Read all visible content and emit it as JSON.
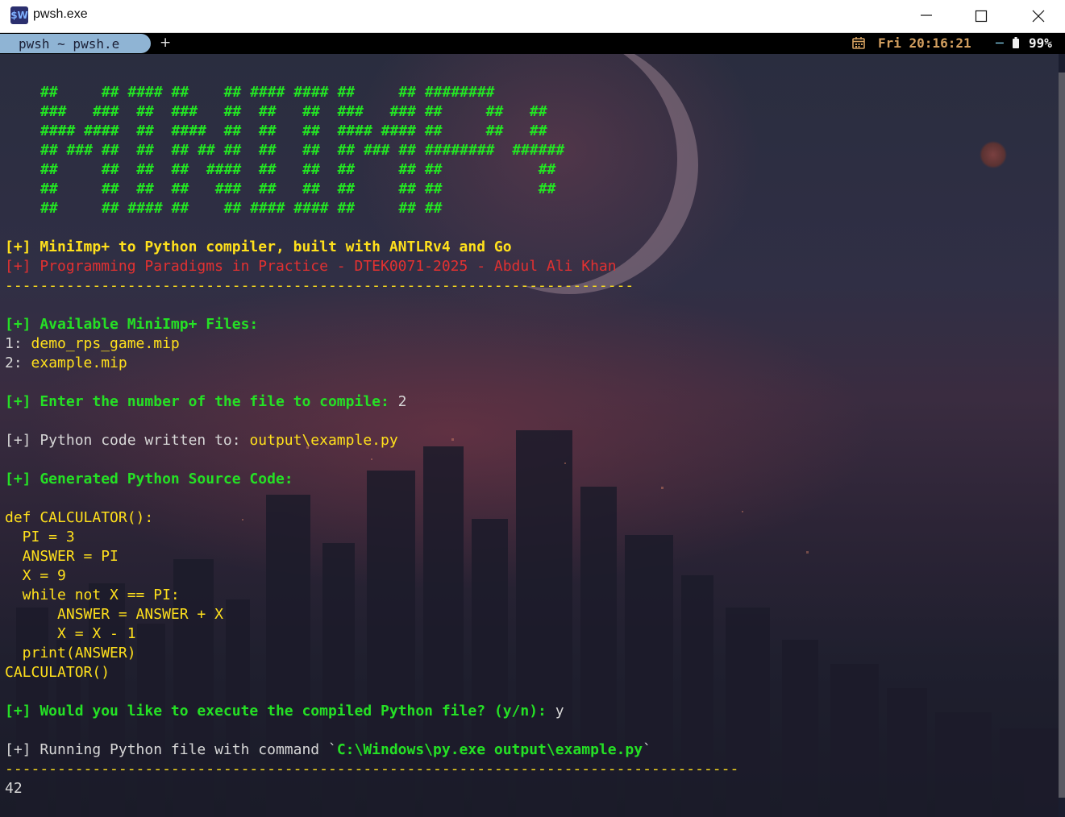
{
  "window": {
    "title": "pwsh.exe",
    "icon_label": "$W",
    "controls": [
      "minimize-icon",
      "maximize-icon",
      "close-icon"
    ]
  },
  "tabbar": {
    "active_tab": "pwsh ~ pwsh.e",
    "new_tab": "+",
    "status_time": "Fri 20:16:21",
    "status_sep": "─",
    "battery": "99%"
  },
  "colors": {
    "ascii_art": "#23e523",
    "info_prefix": "#25e025",
    "highlight": "#ffe01c",
    "error_red": "#e23131",
    "tab_active": "#8fb4d4"
  },
  "terminal": {
    "ascii_art": [
      "##     ## #### ##    ## #### #### ##     ## ########",
      "###   ###  ##  ###   ##  ##   ##  ###   ### ##     ##   ##",
      "#### ####  ##  ####  ##  ##   ##  #### #### ##     ##   ##",
      "## ### ##  ##  ## ## ##  ##   ##  ## ### ## ########  ######",
      "##     ##  ##  ##  ####  ##   ##  ##     ## ##           ##",
      "##     ##  ##  ##   ###  ##   ##  ##     ## ##           ##",
      "##     ## #### ##    ## #### #### ##     ## ##"
    ],
    "banner1": "[+] MiniImp+ to Python compiler, built with ANTLRv4 and Go",
    "banner2": "[+] Programming Paradigms in Practice - DTEK0071-2025 - Abdul Ali Khan",
    "divider1": "------------------------------------------------------------------------",
    "available_header": "[+] Available MiniImp+ Files:",
    "files": [
      {
        "num": "1: ",
        "name": "demo_rps_game.mip"
      },
      {
        "num": "2: ",
        "name": "example.mip"
      }
    ],
    "prompt_select": "[+] Enter the number of the file to compile: ",
    "prompt_select_answer": "2",
    "written_prefix": "[+] Python code written to: ",
    "written_path": "output\\example.py",
    "generated_header": "[+] Generated Python Source Code:",
    "code": [
      "def CALCULATOR():",
      "  PI = 3",
      "  ANSWER = PI",
      "  X = 9",
      "  while not X == PI:",
      "      ANSWER = ANSWER + X",
      "      X = X - 1",
      "  print(ANSWER)",
      "CALCULATOR()"
    ],
    "prompt_execute": "[+] Would you like to execute the compiled Python file? (y/n): ",
    "prompt_execute_answer": "y",
    "running_prefix": "[+] Running Python file with command `",
    "running_command": "C:\\Windows\\py.exe output\\example.py",
    "running_suffix": "`",
    "divider2": "------------------------------------------------------------------------------------",
    "output": "42"
  }
}
